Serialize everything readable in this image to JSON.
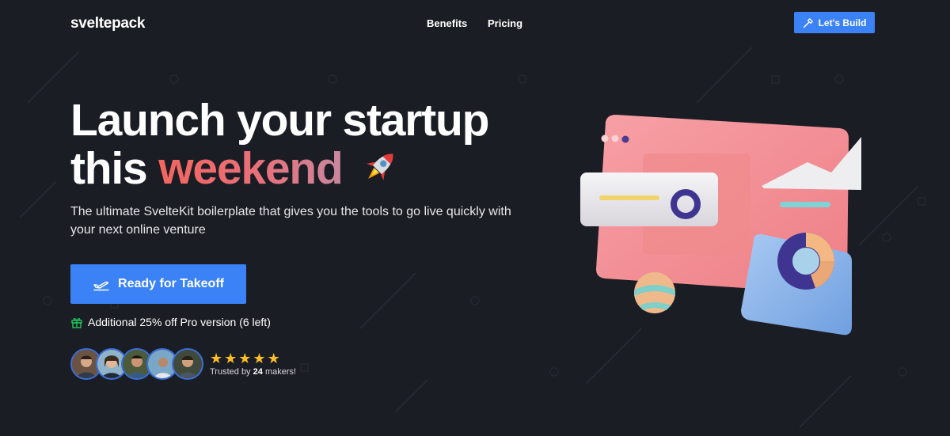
{
  "nav": {
    "logo": "sveltepack",
    "links": [
      "Benefits",
      "Pricing"
    ],
    "cta_label": "Let's Build"
  },
  "hero": {
    "headline_line1": "Launch your startup",
    "headline_line2_prefix": "this",
    "headline_accent": "weekend",
    "rocket_icon": "rocket-emoji",
    "subtitle": "The ultimate SvelteKit boilerplate that gives you the tools to go live quickly with your next online venture",
    "cta_label": "Ready for Takeoff",
    "offer_text": "Additional 25% off Pro version (6 left)",
    "rating_stars": 5,
    "trust_prefix": "Trusted by",
    "trust_count": "24",
    "trust_suffix": "makers!"
  },
  "colors": {
    "background": "#1b1d24",
    "accent_blue": "#3b82f6",
    "headline_gradient_start": "#f2665f",
    "headline_gradient_end": "#c9889e",
    "star": "#fbbf24",
    "gift": "#22c55e"
  }
}
